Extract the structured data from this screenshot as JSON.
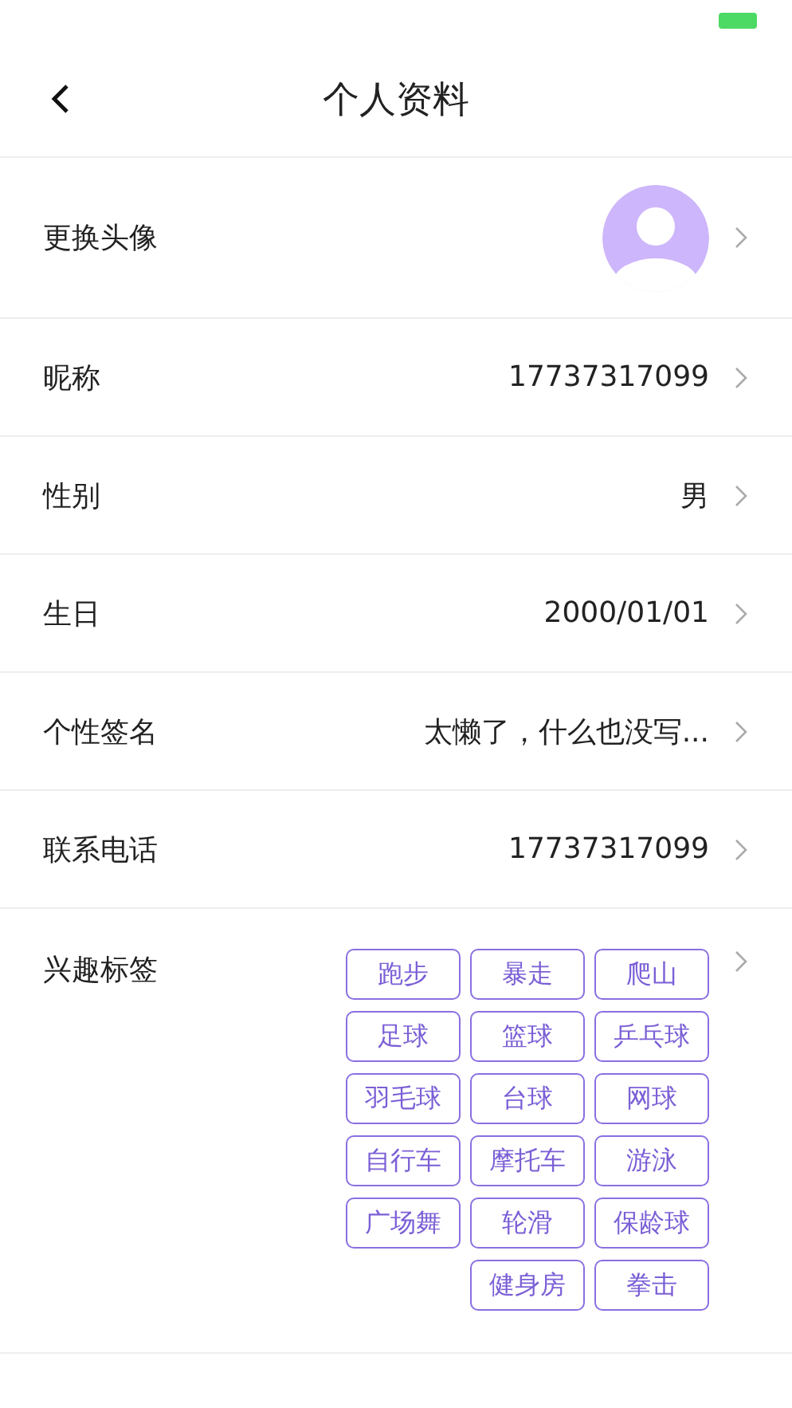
{
  "header": {
    "title": "个人资料"
  },
  "rows": [
    {
      "kind": "avatar",
      "label": "更换头像"
    },
    {
      "kind": "text",
      "label": "昵称",
      "value": "17737317099"
    },
    {
      "kind": "text",
      "label": "性别",
      "value": "男"
    },
    {
      "kind": "text",
      "label": "生日",
      "value": "2000/01/01"
    },
    {
      "kind": "text",
      "label": "个性签名",
      "value": "太懒了，什么也没写..."
    },
    {
      "kind": "text",
      "label": "联系电话",
      "value": "17737317099"
    },
    {
      "kind": "tags",
      "label": "兴趣标签",
      "tags": [
        "跑步",
        "暴走",
        "爬山",
        "足球",
        "篮球",
        "乒乓球",
        "羽毛球",
        "台球",
        "网球",
        "自行车",
        "摩托车",
        "游泳",
        "广场舞",
        "轮滑",
        "保龄球",
        "健身房",
        "拳击"
      ]
    }
  ]
}
